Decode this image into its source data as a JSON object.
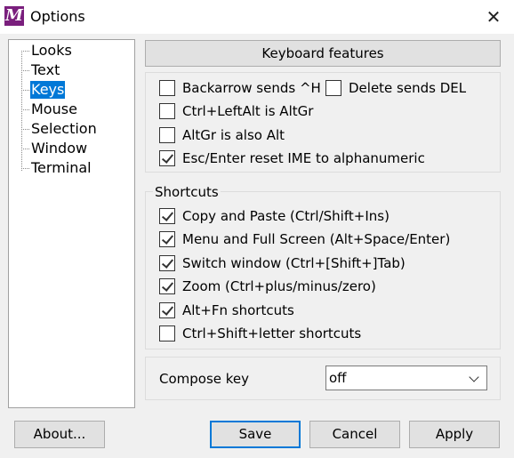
{
  "window": {
    "title": "Options",
    "icon": "mintty-icon",
    "icon_letter": "M",
    "accent_color": "#0078d7",
    "close_symbol": "✕"
  },
  "tree": {
    "items": [
      {
        "label": "Looks",
        "selected": false
      },
      {
        "label": "Text",
        "selected": false
      },
      {
        "label": "Keys",
        "selected": true
      },
      {
        "label": "Mouse",
        "selected": false
      },
      {
        "label": "Selection",
        "selected": false
      },
      {
        "label": "Window",
        "selected": false
      },
      {
        "label": "Terminal",
        "selected": false
      }
    ]
  },
  "panel": {
    "heading": "Keyboard features",
    "keyboard": {
      "backarrow": {
        "label": "Backarrow sends ^H",
        "checked": false
      },
      "delete_del": {
        "label": "Delete sends DEL",
        "checked": false
      },
      "ctrl_leftalt": {
        "label": "Ctrl+LeftAlt is AltGr",
        "checked": false
      },
      "altgr_alt": {
        "label": "AltGr is also Alt",
        "checked": false
      },
      "esc_enter": {
        "label": "Esc/Enter reset IME to alphanumeric",
        "checked": true
      }
    },
    "shortcuts": {
      "title": "Shortcuts",
      "copy_paste": {
        "label": "Copy and Paste (Ctrl/Shift+Ins)",
        "checked": true
      },
      "menu_full": {
        "label": "Menu and Full Screen (Alt+Space/Enter)",
        "checked": true
      },
      "switch_window": {
        "label": "Switch window (Ctrl+[Shift+]Tab)",
        "checked": true
      },
      "zoom": {
        "label": "Zoom (Ctrl+plus/minus/zero)",
        "checked": true
      },
      "alt_fn": {
        "label": "Alt+Fn shortcuts",
        "checked": true
      },
      "ctrl_shift_letter": {
        "label": "Ctrl+Shift+letter shortcuts",
        "checked": false
      }
    },
    "compose": {
      "label": "Compose key",
      "value": "off"
    }
  },
  "buttons": {
    "about": "About...",
    "save": "Save",
    "cancel": "Cancel",
    "apply": "Apply"
  }
}
